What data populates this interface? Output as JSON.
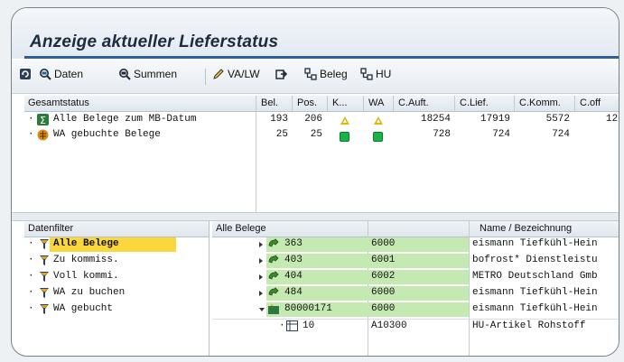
{
  "title": "Anzeige aktueller Lieferstatus",
  "toolbar": {
    "daten": "Daten",
    "summen": "Summen",
    "valw": "VA/LW",
    "beleg": "Beleg",
    "hu": "HU"
  },
  "status": {
    "headers": [
      "Gesamtstatus",
      "Bel.",
      "Pos.",
      "K...",
      "WA",
      "C.Auft.",
      "C.Lief.",
      "C.Komm.",
      "C.off"
    ],
    "rows": [
      {
        "label": "Alle Belege zum MB-Datum",
        "bel": "193",
        "pos": "206",
        "k": "triangle",
        "wa": "triangle",
        "auft": "18254",
        "lief": "17919",
        "komm": "5572",
        "off": "12"
      },
      {
        "label": "WA gebuchte Belege",
        "bel": "25",
        "pos": "25",
        "k": "square",
        "wa": "square",
        "auft": "728",
        "lief": "724",
        "komm": "724",
        "off": ""
      }
    ]
  },
  "filter": {
    "header": "Datenfilter",
    "items": [
      "Alle Belege",
      "Zu kommiss.",
      "Voll kommi.",
      "WA zu buchen",
      "WA gebucht"
    ],
    "selected_index": 0
  },
  "belege": {
    "header": "Alle Belege",
    "col_name": "Name / Bezeichnung",
    "rows": [
      {
        "doc": "363",
        "code": "6000",
        "name": "eismann Tiefkühl-Hein"
      },
      {
        "doc": "403",
        "code": "6001",
        "name": "bofrost* Dienstleistu"
      },
      {
        "doc": "404",
        "code": "6002",
        "name": "METRO Deutschland Gmb"
      },
      {
        "doc": "484",
        "code": "6000",
        "name": "eismann Tiefkühl-Hein"
      },
      {
        "doc": "80000171",
        "code": "6000",
        "name": "eismann Tiefkühl-Hein"
      },
      {
        "doc": "10",
        "code": "A10300",
        "name": "HU-Artikel Rohstoff"
      }
    ]
  },
  "colors": {
    "accent": "#2c5f9e",
    "selected": "#fbd63c",
    "green_row": "#c5eab1",
    "status_yellow": "#e2b60a",
    "status_green": "#19b347"
  }
}
